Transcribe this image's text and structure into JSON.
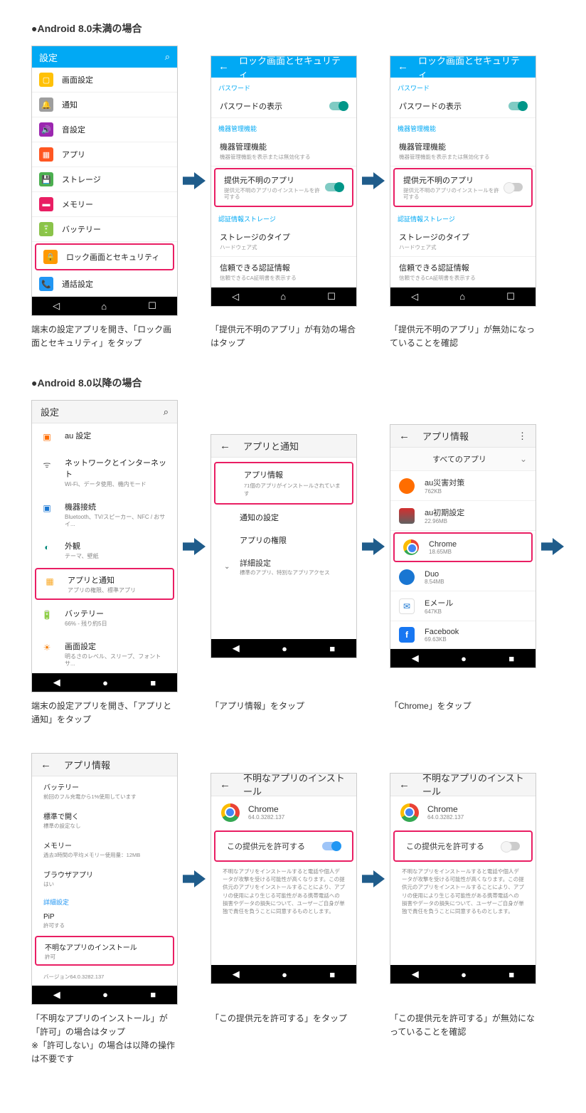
{
  "sections": {
    "pre8": "●Android 8.0未満の場合",
    "post8": "●Android 8.0以降の場合"
  },
  "captions": {
    "a1": "端末の設定アプリを開き、「ロック画面とセキュリティ」をタップ",
    "a2": "「提供元不明のアプリ」が有効の場合はタップ",
    "a3": "「提供元不明のアプリ」が無効になっていることを確認",
    "b1": "端末の設定アプリを開き、「アプリと通知」をタップ",
    "b2": "「アプリ情報」をタップ",
    "b3": "「Chrome」をタップ",
    "c1": "「不明なアプリのインストール」が「許可」の場合はタップ\n※「許可しない」の場合は以降の操作は不要です",
    "c2": "「この提供元を許可する」をタップ",
    "c3": "「この提供元を許可する」が無効になっていることを確認"
  },
  "p1": {
    "title": "設定",
    "items": [
      "画面設定",
      "通知",
      "音設定",
      "アプリ",
      "ストレージ",
      "メモリー",
      "バッテリー",
      "ロック画面とセキュリティ",
      "通話設定"
    ]
  },
  "p2": {
    "title": "ロック画面とセキュリティ",
    "sec1": "パスワード",
    "i1": "パスワードの表示",
    "sec2": "機器管理機能",
    "i2": "機器管理機能",
    "i2s": "機器管理機能を表示または無効化する",
    "i3": "提供元不明のアプリ",
    "i3s": "提供元不明のアプリのインストールを許可する",
    "sec3": "認証情報ストレージ",
    "i4": "ストレージのタイプ",
    "i4s": "ハードウェア式",
    "i5": "信頼できる認証情報",
    "i5s": "信頼できるCA証明書を表示する"
  },
  "p4": {
    "title": "設定",
    "i1": "au 設定",
    "i2": "ネットワークとインターネット",
    "i2s": "Wi-Fi、データ使用、機内モード",
    "i3": "機器接続",
    "i3s": "Bluetooth、TV/スピーカー、NFC / おサイ...",
    "i4": "外観",
    "i4s": "テーマ、壁紙",
    "i5": "アプリと通知",
    "i5s": "アプリの権限、標準アプリ",
    "i6": "バッテリー",
    "i6s": "66% - 残り約5日",
    "i7": "画面設定",
    "i7s": "明るさのレベル、スリープ、フォントサ..."
  },
  "p5": {
    "title": "アプリと通知",
    "i1": "アプリ情報",
    "i1s": "71個のアプリがインストールされています",
    "i2": "通知の設定",
    "i3": "アプリの権限",
    "i4": "詳細設定",
    "i4s": "標準のアプリ、特別なアプリアクセス"
  },
  "p6": {
    "title": "アプリ情報",
    "all": "すべてのアプリ",
    "apps": [
      {
        "n": "au災害対策",
        "s": "762KB"
      },
      {
        "n": "au初期設定",
        "s": "22.96MB"
      },
      {
        "n": "Chrome",
        "s": "18.65MB"
      },
      {
        "n": "Duo",
        "s": "8.54MB"
      },
      {
        "n": "Eメール",
        "s": "647KB"
      },
      {
        "n": "Facebook",
        "s": "69.63KB"
      }
    ]
  },
  "p7": {
    "title": "アプリ情報",
    "i0": "バッテリー",
    "i0s": "前回のフル充電から1%使用しています",
    "i1": "標準で開く",
    "i1s": "標準の設定なし",
    "i2": "メモリー",
    "i2s": "過去3時間の平均メモリー使用量：12MB",
    "i3": "ブラウザアプリ",
    "i3s": "はい",
    "sec": "詳細設定",
    "i4": "PiP",
    "i4s": "許可する",
    "i5": "不明なアプリのインストール",
    "i5s": "許可",
    "ver": "バージョン64.0.3282.137"
  },
  "p8": {
    "title": "不明なアプリのインストール",
    "app": "Chrome",
    "ver": "64.0.3282.137",
    "allow": "この提供元を許可する",
    "warn": "不明なアプリをインストールすると電話や個人データが攻撃を受ける可能性が高くなります。この提供元のアプリをインストールすることにより、アプリの使用により生じる可能性がある携帯電話への損害やデータの損失について、ユーザーご自身が単独で責任を負うことに同意するものとします。"
  }
}
